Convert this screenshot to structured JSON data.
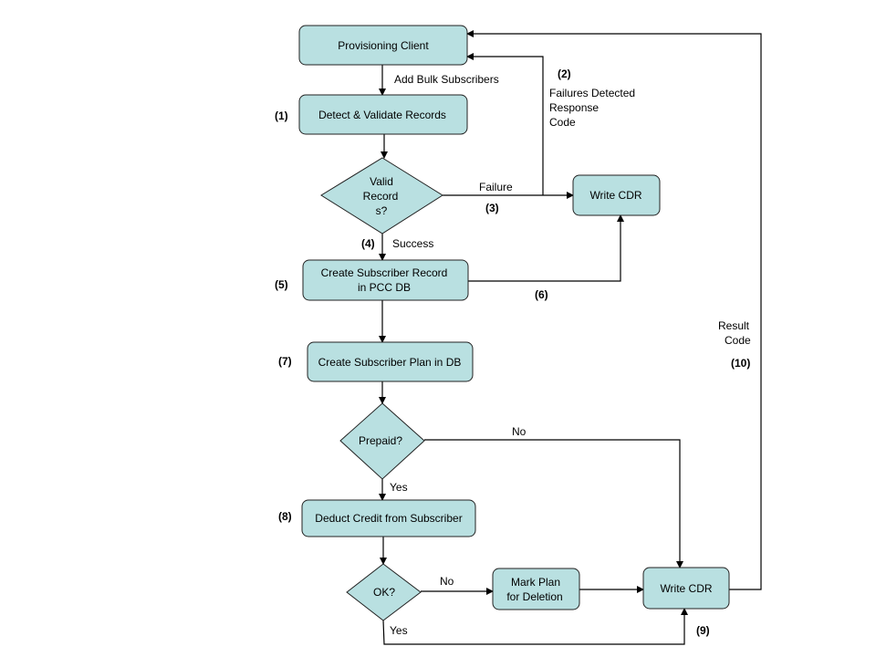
{
  "nodes": {
    "provisioning_client": "Provisioning  Client",
    "detect_validate": "Detect & Validate Records",
    "valid_records": [
      "Valid",
      "Record",
      "s?"
    ],
    "write_cdr_top": "Write CDR",
    "create_record": [
      "Create Subscriber Record",
      "in PCC DB"
    ],
    "create_plan": "Create Subscriber Plan in DB",
    "prepaid": "Prepaid?",
    "deduct_credit": "Deduct Credit from Subscriber",
    "ok": "OK?",
    "mark_plan": [
      "Mark Plan",
      "for Deletion"
    ],
    "write_cdr_bottom": "Write CDR"
  },
  "edge_labels": {
    "add_bulk": "Add Bulk Subscribers",
    "failures_detected": [
      "Failures Detected",
      "Response",
      "Code"
    ],
    "failure": "Failure",
    "success": "Success",
    "prepaid_no": "No",
    "prepaid_yes": "Yes",
    "ok_no": "No",
    "ok_yes": "Yes",
    "result_code": [
      "Result",
      "Code"
    ]
  },
  "step_numbers": {
    "s1": "(1)",
    "s2": "(2)",
    "s3": "(3)",
    "s4": "(4)",
    "s5": "(5)",
    "s6": "(6)",
    "s7": "(7)",
    "s8": "(8)",
    "s9": "(9)",
    "s10": "(10)"
  },
  "colors": {
    "node_fill": "#b9e0e1",
    "line": "#000000"
  }
}
